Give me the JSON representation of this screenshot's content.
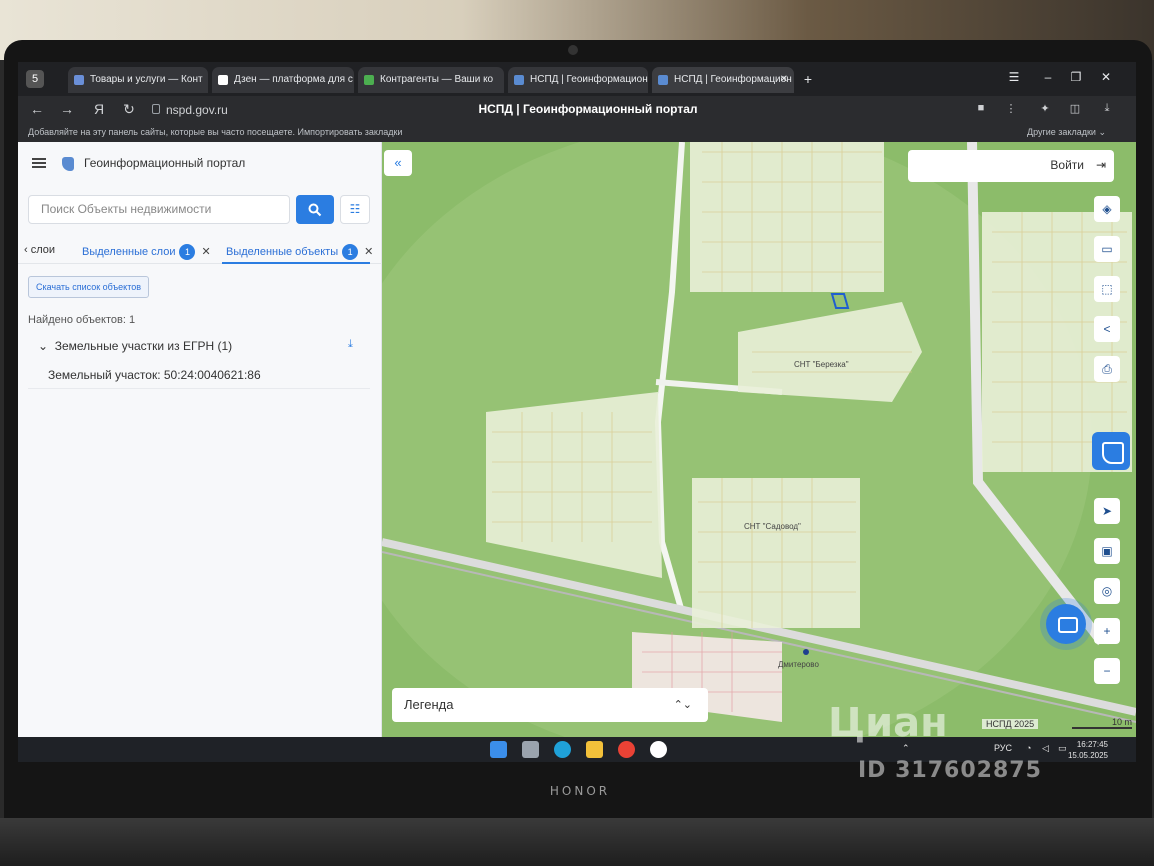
{
  "browser": {
    "tabs": [
      {
        "label": "Товары и услуги — Конт",
        "favicon_color": "#6a8fd8",
        "active": false
      },
      {
        "label": "Дзен — платформа для с",
        "favicon_color": "#ffffff",
        "active": false
      },
      {
        "label": "Контрагенты — Ваши ко",
        "favicon_color": "#4caf50",
        "active": false
      },
      {
        "label": "НСПД | Геоинформацион",
        "favicon_color": "#5a8bd1",
        "active": false
      },
      {
        "label": "НСПД | Геоинформацион",
        "favicon_color": "#5a8bd1",
        "active": true
      }
    ],
    "url": "nspd.gov.ru",
    "page_title": "НСПД | Геоинформационный портал",
    "bookmarks_hint": "Добавляйте на эту панель сайты, которые вы часто посещаете.",
    "import_bookmarks": "Импортировать закладки",
    "other_bookmarks": "Другие закладки"
  },
  "app": {
    "portal_title": "Геоинформационный портал",
    "search_placeholder": "Поиск Объекты недвижимости",
    "tabs": {
      "layers": "слои",
      "selected_layers": "Выделенные слои",
      "selected_layers_count": "1",
      "selected_objects": "Выделенные объекты",
      "selected_objects_count": "1"
    },
    "download_list_button": "Скачать список объектов",
    "found_text": "Найдено объектов: 1",
    "group_title": "Земельные участки из ЕГРН (1)",
    "item_text": "Земельный участок: 50:24:0040621:86"
  },
  "map": {
    "login_label": "Войти",
    "legend_label": "Легенда",
    "attribution": "НСПД 2025",
    "scale_label": "10 m",
    "labels": {
      "snt_1": "СНТ \"Березка\"",
      "snt_2": "СНТ \"Садовод\"",
      "village": "Дмитерово"
    },
    "colors": {
      "background": "#8cbc6a",
      "plots": "#e9f0d8",
      "highlight": "#1f5fcf"
    }
  },
  "taskbar": {
    "language": "РУС",
    "time": "16:27:45",
    "date": "15.05.2025"
  },
  "device": {
    "brand": "HONOR"
  },
  "watermark": {
    "logo": "Циан",
    "id": "ID 317602875"
  }
}
